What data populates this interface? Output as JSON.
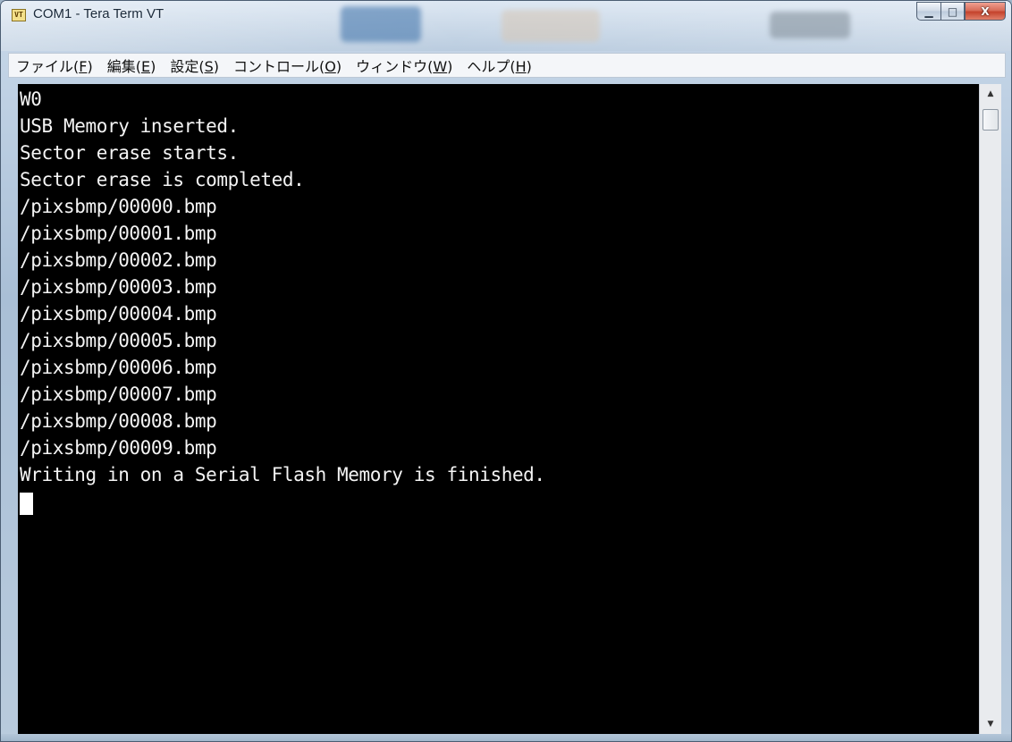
{
  "window": {
    "title": "COM1 - Tera Term VT",
    "icon": "tera-term-icon",
    "icon_text": "VT"
  },
  "caption_buttons": {
    "minimize": "minimize-icon",
    "maximize": "maximize-icon",
    "close": "close-icon",
    "minimize_glyph": "▁",
    "maximize_glyph": "□",
    "close_glyph": "X"
  },
  "menu": {
    "items": [
      {
        "label": "ファイル(",
        "accel": "F",
        "tail": ")"
      },
      {
        "label": "編集(",
        "accel": "E",
        "tail": ")"
      },
      {
        "label": "設定(",
        "accel": "S",
        "tail": ")"
      },
      {
        "label": "コントロール(",
        "accel": "O",
        "tail": ")"
      },
      {
        "label": "ウィンドウ(",
        "accel": "W",
        "tail": ")"
      },
      {
        "label": "ヘルプ(",
        "accel": "H",
        "tail": ")"
      }
    ]
  },
  "terminal": {
    "lines": [
      "W0",
      "USB Memory inserted.",
      "Sector erase starts.",
      "Sector erase is completed.",
      "/pixsbmp/00000.bmp",
      "/pixsbmp/00001.bmp",
      "/pixsbmp/00002.bmp",
      "/pixsbmp/00003.bmp",
      "/pixsbmp/00004.bmp",
      "/pixsbmp/00005.bmp",
      "/pixsbmp/00006.bmp",
      "/pixsbmp/00007.bmp",
      "/pixsbmp/00008.bmp",
      "/pixsbmp/00009.bmp",
      "Writing in on a Serial Flash Memory is finished."
    ],
    "foreground": "#f4f4f4",
    "background": "#000000"
  },
  "scrollbar": {
    "up_arrow": "▲",
    "down_arrow": "▼"
  }
}
